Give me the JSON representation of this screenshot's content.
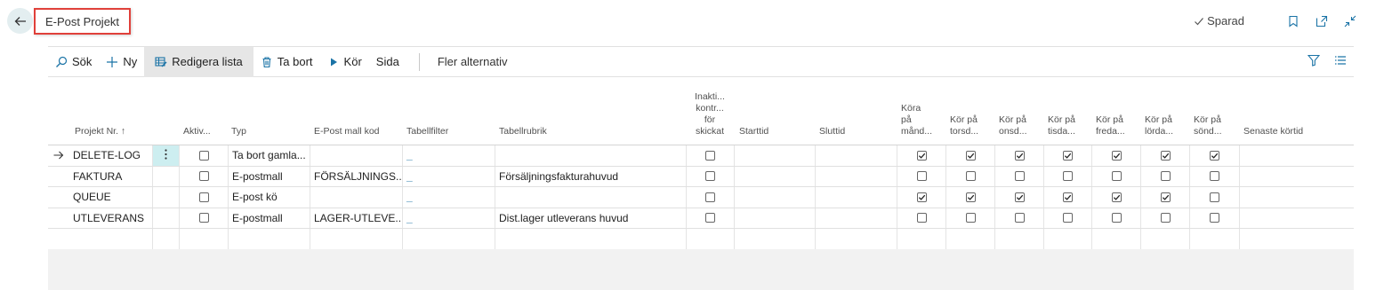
{
  "header": {
    "title": "E-Post Projekt",
    "saved_label": "Sparad"
  },
  "toolbar": {
    "search": "Sök",
    "new": "Ny",
    "edit_list": "Redigera lista",
    "delete": "Ta bort",
    "run": "Kör",
    "page": "Sida",
    "more": "Fler alternativ"
  },
  "columns": {
    "project_no": "Projekt Nr. ↑",
    "active": "Aktiv...",
    "type": "Typ",
    "template_code": "E-Post mall kod",
    "table_filter": "Tabellfilter",
    "table_caption": "Tabellrubrik",
    "inactive_control": [
      "Inakti...",
      "kontr...",
      "för",
      "skickat"
    ],
    "start_time": "Starttid",
    "end_time": "Sluttid",
    "run_mon": [
      "Köra",
      "på",
      "månd..."
    ],
    "run_thu": [
      "Kör på",
      "torsd..."
    ],
    "run_wed": [
      "Kör på",
      "onsd..."
    ],
    "run_tue": [
      "Kör på",
      "tisda..."
    ],
    "run_fri": [
      "Kör på",
      "freda..."
    ],
    "run_sat": [
      "Kör på",
      "lörda..."
    ],
    "run_sun": [
      "Kör på",
      "sönd..."
    ],
    "last_run": "Senaste körtid"
  },
  "rows": [
    {
      "project_no": "DELETE-LOG",
      "active": false,
      "type": "Ta bort gamla...",
      "template_code": "",
      "table_filter": "_",
      "table_caption": "",
      "inactive_control": false,
      "start_time": "",
      "end_time": "",
      "days": [
        true,
        true,
        true,
        true,
        true,
        true,
        true
      ],
      "last_run": ""
    },
    {
      "project_no": "FAKTURA",
      "active": false,
      "type": "E-postmall",
      "template_code": "FÖRSÄLJNINGS...",
      "table_filter": "_",
      "table_caption": "Försäljningsfakturahuvud",
      "inactive_control": false,
      "start_time": "",
      "end_time": "",
      "days": [
        false,
        false,
        false,
        false,
        false,
        false,
        false
      ],
      "last_run": ""
    },
    {
      "project_no": "QUEUE",
      "active": false,
      "type": "E-post kö",
      "template_code": "",
      "table_filter": "_",
      "table_caption": "",
      "inactive_control": false,
      "start_time": "",
      "end_time": "",
      "days": [
        true,
        true,
        true,
        true,
        true,
        true,
        false
      ],
      "last_run": ""
    },
    {
      "project_no": "UTLEVERANS",
      "active": false,
      "type": "E-postmall",
      "template_code": "LAGER-UTLEVE...",
      "table_filter": "_",
      "table_caption": "Dist.lager utleverans huvud",
      "inactive_control": false,
      "start_time": "",
      "end_time": "",
      "days": [
        false,
        false,
        false,
        false,
        false,
        false,
        false
      ],
      "last_run": ""
    }
  ],
  "colors": {
    "accent": "#1a73a6",
    "title_border": "#e0403a",
    "selected_cell": "#cdeef0"
  }
}
